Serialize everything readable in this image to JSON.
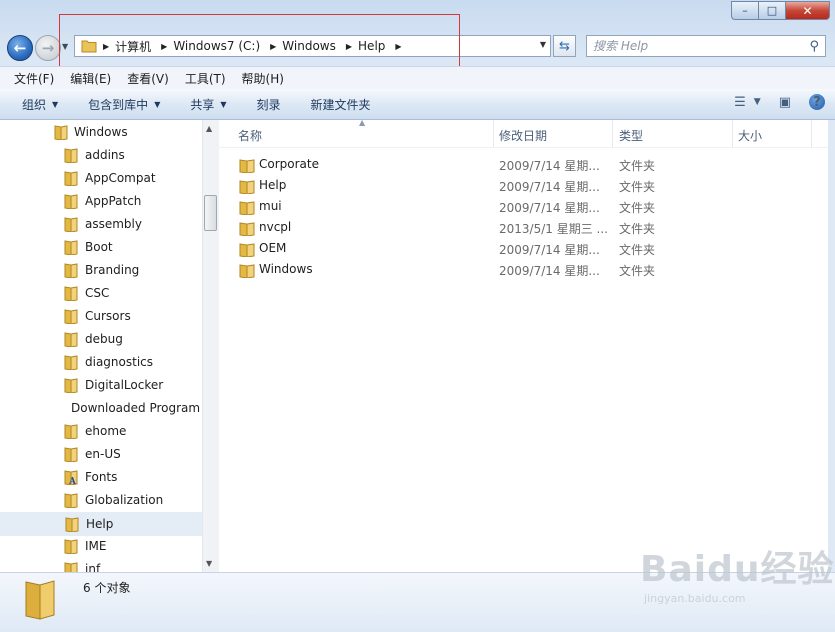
{
  "titlebar": {
    "min": "–",
    "max": "□",
    "close": "✕"
  },
  "nav": {
    "back": "←",
    "forward": "→",
    "history": "▼"
  },
  "address": {
    "segments": [
      "计算机",
      "Windows7 (C:)",
      "Windows",
      "Help"
    ],
    "dropdown": "▼",
    "refresh": "⇆"
  },
  "search": {
    "placeholder": "搜索 Help",
    "icon": "⚲"
  },
  "menu": [
    "文件(F)",
    "编辑(E)",
    "查看(V)",
    "工具(T)",
    "帮助(H)"
  ],
  "commands": {
    "organize": "组织",
    "include_library": "包含到库中",
    "share": "共享",
    "burn": "刻录",
    "new_folder": "新建文件夹",
    "help": "?"
  },
  "tree": {
    "root": "Windows",
    "items": [
      "addins",
      "AppCompat",
      "AppPatch",
      "assembly",
      "Boot",
      "Branding",
      "CSC",
      "Cursors",
      "debug",
      "diagnostics",
      "DigitalLocker",
      "Downloaded Program Files",
      "ehome",
      "en-US",
      "Fonts",
      "Globalization",
      "Help",
      "IME",
      "inf"
    ],
    "selected": "Help"
  },
  "columns": {
    "name": "名称",
    "date": "修改日期",
    "type": "类型",
    "size": "大小"
  },
  "files": [
    {
      "name": "Corporate",
      "date": "2009/7/14 星期...",
      "type": "文件夹"
    },
    {
      "name": "Help",
      "date": "2009/7/14 星期...",
      "type": "文件夹"
    },
    {
      "name": "mui",
      "date": "2009/7/14 星期...",
      "type": "文件夹"
    },
    {
      "name": "nvcpl",
      "date": "2013/5/1 星期三 ...",
      "type": "文件夹"
    },
    {
      "name": "OEM",
      "date": "2009/7/14 星期...",
      "type": "文件夹"
    },
    {
      "name": "Windows",
      "date": "2009/7/14 星期...",
      "type": "文件夹"
    }
  ],
  "status": {
    "count": "6 个对象"
  },
  "watermark": {
    "brand": "Baidu经验",
    "url": "jingyan.baidu.com"
  }
}
